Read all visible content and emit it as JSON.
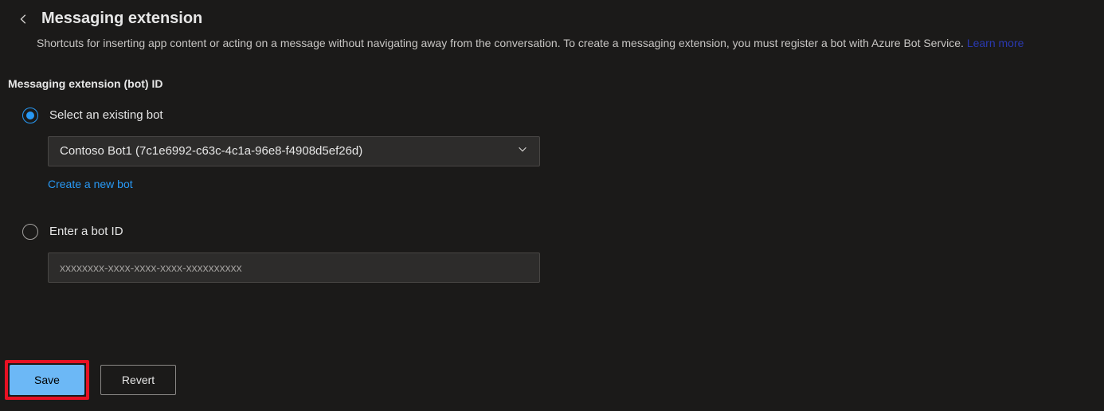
{
  "header": {
    "title": "Messaging extension",
    "description": "Shortcuts for inserting app content or acting on a message without navigating away from the conversation. To create a messaging extension, you must register a bot with Azure Bot Service. ",
    "learn_more": "Learn more"
  },
  "section": {
    "title": "Messaging extension (bot) ID",
    "option_existing_label": "Select an existing bot",
    "option_enter_label": "Enter a bot ID",
    "dropdown_value": "Contoso Bot1 (7c1e6992-c63c-4c1a-96e8-f4908d5ef26d)",
    "create_link": "Create a new bot",
    "bot_id_placeholder": "xxxxxxxx-xxxx-xxxx-xxxx-xxxxxxxxxx"
  },
  "buttons": {
    "save": "Save",
    "revert": "Revert"
  }
}
